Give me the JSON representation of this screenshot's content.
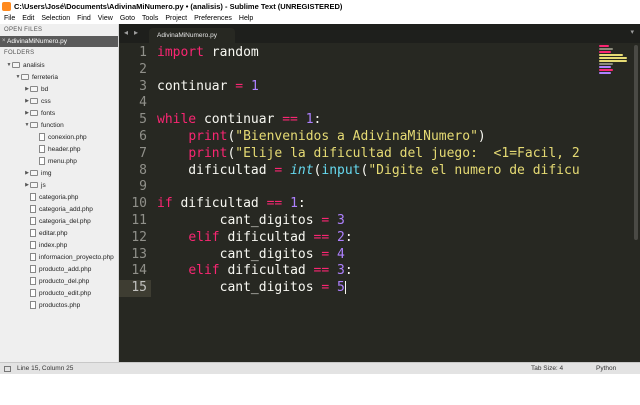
{
  "window": {
    "title": "C:\\Users\\José\\Documents\\AdivinaMiNumero.py • (analisis) - Sublime Text (UNREGISTERED)"
  },
  "menu": [
    "File",
    "Edit",
    "Selection",
    "Find",
    "View",
    "Goto",
    "Tools",
    "Project",
    "Preferences",
    "Help"
  ],
  "sidebar": {
    "open_files_header": "OPEN FILES",
    "open_file": "AdivinaMiNumero.py",
    "open_file_close": "×",
    "folders_header": "FOLDERS",
    "tree": [
      {
        "label": "analisis",
        "type": "folder",
        "depth": 0,
        "expanded": true
      },
      {
        "label": "ferreteria",
        "type": "folder",
        "depth": 1,
        "expanded": true
      },
      {
        "label": "bd",
        "type": "folder",
        "depth": 2,
        "expanded": false
      },
      {
        "label": "css",
        "type": "folder",
        "depth": 2,
        "expanded": false
      },
      {
        "label": "fonts",
        "type": "folder",
        "depth": 2,
        "expanded": false
      },
      {
        "label": "function",
        "type": "folder",
        "depth": 2,
        "expanded": true
      },
      {
        "label": "conexion.php",
        "type": "file",
        "depth": 3
      },
      {
        "label": "header.php",
        "type": "file",
        "depth": 3
      },
      {
        "label": "menu.php",
        "type": "file",
        "depth": 3
      },
      {
        "label": "img",
        "type": "folder",
        "depth": 2,
        "expanded": false
      },
      {
        "label": "js",
        "type": "folder",
        "depth": 2,
        "expanded": false
      },
      {
        "label": "categoria.php",
        "type": "file",
        "depth": 2
      },
      {
        "label": "categoria_add.php",
        "type": "file",
        "depth": 2
      },
      {
        "label": "categoria_del.php",
        "type": "file",
        "depth": 2
      },
      {
        "label": "editar.php",
        "type": "file",
        "depth": 2
      },
      {
        "label": "index.php",
        "type": "file",
        "depth": 2
      },
      {
        "label": "informacion_proyecto.php",
        "type": "file",
        "depth": 2
      },
      {
        "label": "producto_add.php",
        "type": "file",
        "depth": 2
      },
      {
        "label": "producto_del.php",
        "type": "file",
        "depth": 2
      },
      {
        "label": "producto_edit.php",
        "type": "file",
        "depth": 2
      },
      {
        "label": "productos.php",
        "type": "file",
        "depth": 2
      }
    ]
  },
  "editor": {
    "tab_label": "AdivinaMiNumero.py",
    "tab_prev": "◂",
    "tab_next": "▸",
    "tab_menu": "▾",
    "active_line": 15,
    "lines": [
      [
        {
          "t": "import",
          "c": "kw"
        },
        {
          "t": " random",
          "c": ""
        }
      ],
      [],
      [
        {
          "t": "continuar ",
          "c": ""
        },
        {
          "t": "=",
          "c": "kw"
        },
        {
          "t": " ",
          "c": ""
        },
        {
          "t": "1",
          "c": "num"
        }
      ],
      [],
      [
        {
          "t": "while",
          "c": "kw"
        },
        {
          "t": " continuar ",
          "c": ""
        },
        {
          "t": "==",
          "c": "kw"
        },
        {
          "t": " ",
          "c": ""
        },
        {
          "t": "1",
          "c": "num"
        },
        {
          "t": ":",
          "c": ""
        }
      ],
      [
        {
          "t": "    ",
          "c": ""
        },
        {
          "t": "print",
          "c": "kw"
        },
        {
          "t": "(",
          "c": ""
        },
        {
          "t": "\"Bienvenidos a AdivinaMiNumero\"",
          "c": "str"
        },
        {
          "t": ")",
          "c": ""
        }
      ],
      [
        {
          "t": "    ",
          "c": ""
        },
        {
          "t": "print",
          "c": "kw"
        },
        {
          "t": "(",
          "c": ""
        },
        {
          "t": "\"Elije la dificultad del juego:  <1=Facil, 2",
          "c": "str"
        }
      ],
      [
        {
          "t": "    dificultad ",
          "c": ""
        },
        {
          "t": "=",
          "c": "kw"
        },
        {
          "t": " ",
          "c": ""
        },
        {
          "t": "int",
          "c": "bi"
        },
        {
          "t": "(",
          "c": ""
        },
        {
          "t": "input",
          "c": "fn"
        },
        {
          "t": "(",
          "c": ""
        },
        {
          "t": "\"Digite el numero de dificu",
          "c": "str"
        }
      ],
      [],
      [
        {
          "t": "if",
          "c": "kw"
        },
        {
          "t": " dificultad ",
          "c": ""
        },
        {
          "t": "==",
          "c": "kw"
        },
        {
          "t": " ",
          "c": ""
        },
        {
          "t": "1",
          "c": "num"
        },
        {
          "t": ":",
          "c": ""
        }
      ],
      [
        {
          "t": "        cant_digitos ",
          "c": ""
        },
        {
          "t": "=",
          "c": "kw"
        },
        {
          "t": " ",
          "c": ""
        },
        {
          "t": "3",
          "c": "num"
        }
      ],
      [
        {
          "t": "    ",
          "c": ""
        },
        {
          "t": "elif",
          "c": "kw"
        },
        {
          "t": " dificultad ",
          "c": ""
        },
        {
          "t": "==",
          "c": "kw"
        },
        {
          "t": " ",
          "c": ""
        },
        {
          "t": "2",
          "c": "num"
        },
        {
          "t": ":",
          "c": ""
        }
      ],
      [
        {
          "t": "        cant_digitos ",
          "c": ""
        },
        {
          "t": "=",
          "c": "kw"
        },
        {
          "t": " ",
          "c": ""
        },
        {
          "t": "4",
          "c": "num"
        }
      ],
      [
        {
          "t": "    ",
          "c": ""
        },
        {
          "t": "elif",
          "c": "kw"
        },
        {
          "t": " dificultad ",
          "c": ""
        },
        {
          "t": "==",
          "c": "kw"
        },
        {
          "t": " ",
          "c": ""
        },
        {
          "t": "3",
          "c": "num"
        },
        {
          "t": ":",
          "c": ""
        }
      ],
      [
        {
          "t": "        cant_digitos ",
          "c": ""
        },
        {
          "t": "=",
          "c": "kw"
        },
        {
          "t": " ",
          "c": ""
        },
        {
          "t": "5",
          "c": "num"
        }
      ]
    ]
  },
  "status": {
    "position": "Line 15, Column 25",
    "tab_size": "Tab Size: 4",
    "syntax": "Python"
  },
  "colors": {
    "editor_bg": "#272822",
    "keyword": "#f92672",
    "number": "#ae81ff",
    "string": "#e6db74",
    "builtin": "#66d9ef"
  }
}
